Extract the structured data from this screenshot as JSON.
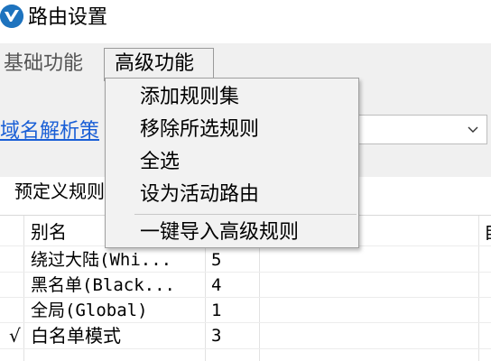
{
  "window": {
    "title": "路由设置"
  },
  "menubar": {
    "basic_label": "基础功能",
    "advanced_label": "高级功能"
  },
  "toolbar": {
    "dns_link": "域名解析策",
    "combo_value": ""
  },
  "tabs": {
    "predefined_label": "预定义规则"
  },
  "table": {
    "headers": {
      "alias": "别名",
      "index": "",
      "right": "自"
    },
    "rows": [
      {
        "check": "",
        "alias": "绕过大陆(Whi...",
        "value": "5"
      },
      {
        "check": "",
        "alias": "黑名单(Black...",
        "value": "4"
      },
      {
        "check": "",
        "alias": "全局(Global)",
        "value": "1"
      },
      {
        "check": "√",
        "alias": "白名单模式",
        "value": "3"
      }
    ]
  },
  "dropdown": {
    "items": [
      "添加规则集",
      "移除所选规则",
      "全选",
      "设为活动路由",
      "一键导入高级规则"
    ]
  },
  "colors": {
    "accent": "#1a5fd6",
    "logo": "#1e73be"
  }
}
